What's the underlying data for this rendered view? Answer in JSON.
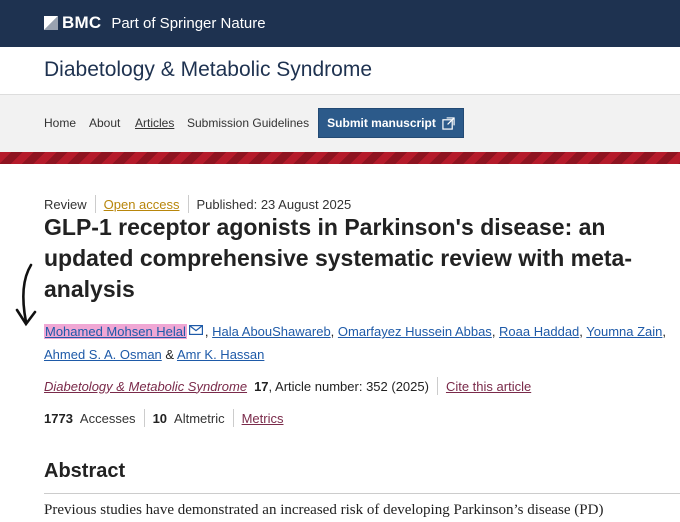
{
  "header": {
    "brand": "BMC",
    "tagline": "Part of Springer Nature"
  },
  "journal": {
    "title": "Diabetology & Metabolic Syndrome"
  },
  "nav": {
    "items": [
      "Home",
      "About",
      "Articles",
      "Submission Guidelines"
    ],
    "current": "Articles",
    "submit_label": "Submit manuscript"
  },
  "article": {
    "type": "Review",
    "access": "Open access",
    "published": "Published: 23 August 2025",
    "title_line1": "GLP-1 receptor agonists in Parkinson's disease: an",
    "title_line2": "updated comprehensive systematic review with meta-",
    "title_line3": "analysis",
    "authors": [
      "Mohamed Mohsen Helal",
      "Hala AbouShawareb",
      "Omarfayez Hussein Abbas",
      "Roaa Haddad",
      "Youmna Zain",
      "Ahmed S. A. Osman",
      "Amr K. Hassan"
    ],
    "citation": {
      "journal": "Diabetology & Metabolic Syndrome",
      "volume": "17",
      "article_info": ", Article number: 352 (2025)",
      "cite_label": "Cite this article"
    },
    "metrics": {
      "accesses_count": "1773",
      "accesses_label": "Accesses",
      "altmetric_count": "10",
      "altmetric_label": "Altmetric",
      "metrics_label": "Metrics"
    }
  },
  "abstract": {
    "heading": "Abstract",
    "text": "Previous studies have demonstrated an increased risk of developing Parkinson’s disease (PD)"
  },
  "colors": {
    "topbar": "#1e3250",
    "button": "#2c5a8a",
    "highlight": "#f0a7d4",
    "link": "#1e5aa8"
  }
}
